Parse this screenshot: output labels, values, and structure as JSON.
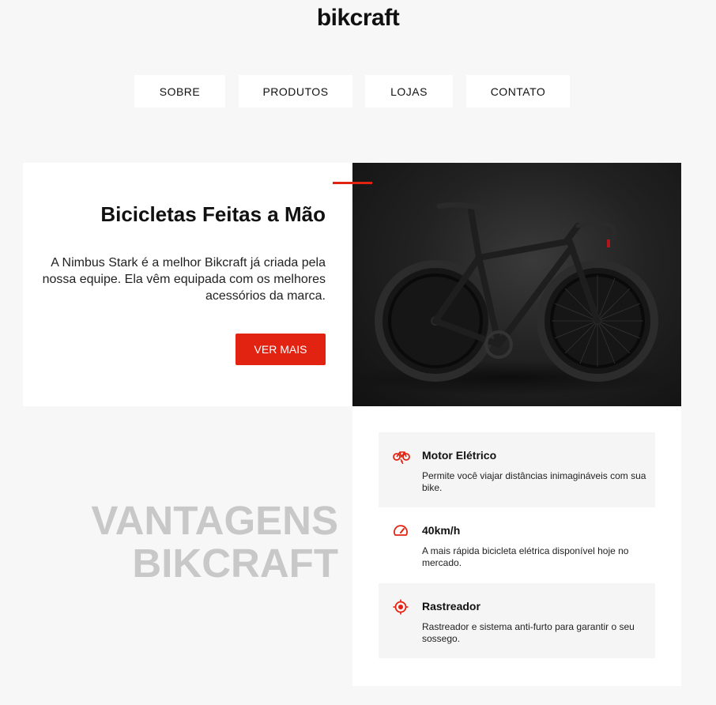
{
  "brand": {
    "logo_text": "bikcraft",
    "accent_color": "#e32312"
  },
  "nav": {
    "items": [
      {
        "label": "SOBRE"
      },
      {
        "label": "PRODUTOS"
      },
      {
        "label": "LOJAS"
      },
      {
        "label": "CONTATO"
      }
    ]
  },
  "hero": {
    "title": "Bicicletas Feitas a Mão",
    "description": "A Nimbus Stark é a melhor Bikcraft já criada pela nossa equipe. Ela vêm equipada com os melhores acessórios da marca.",
    "button_label": "VER MAIS",
    "image_icon": "road-bike-photo"
  },
  "advantages": {
    "heading_line1": "VANTAGENS",
    "heading_line2": "BIKCRAFT",
    "items": [
      {
        "icon": "electric-bike-icon",
        "title": "Motor Elétrico",
        "description": "Permite você viajar distâncias inimagináveis com sua bike."
      },
      {
        "icon": "speedometer-icon",
        "title": "40km/h",
        "description": "A mais rápida bicicleta elétrica disponível hoje no mercado."
      },
      {
        "icon": "target-icon",
        "title": "Rastreador",
        "description": "Rastreador e sistema anti-furto para garantir o seu sossego."
      }
    ]
  }
}
